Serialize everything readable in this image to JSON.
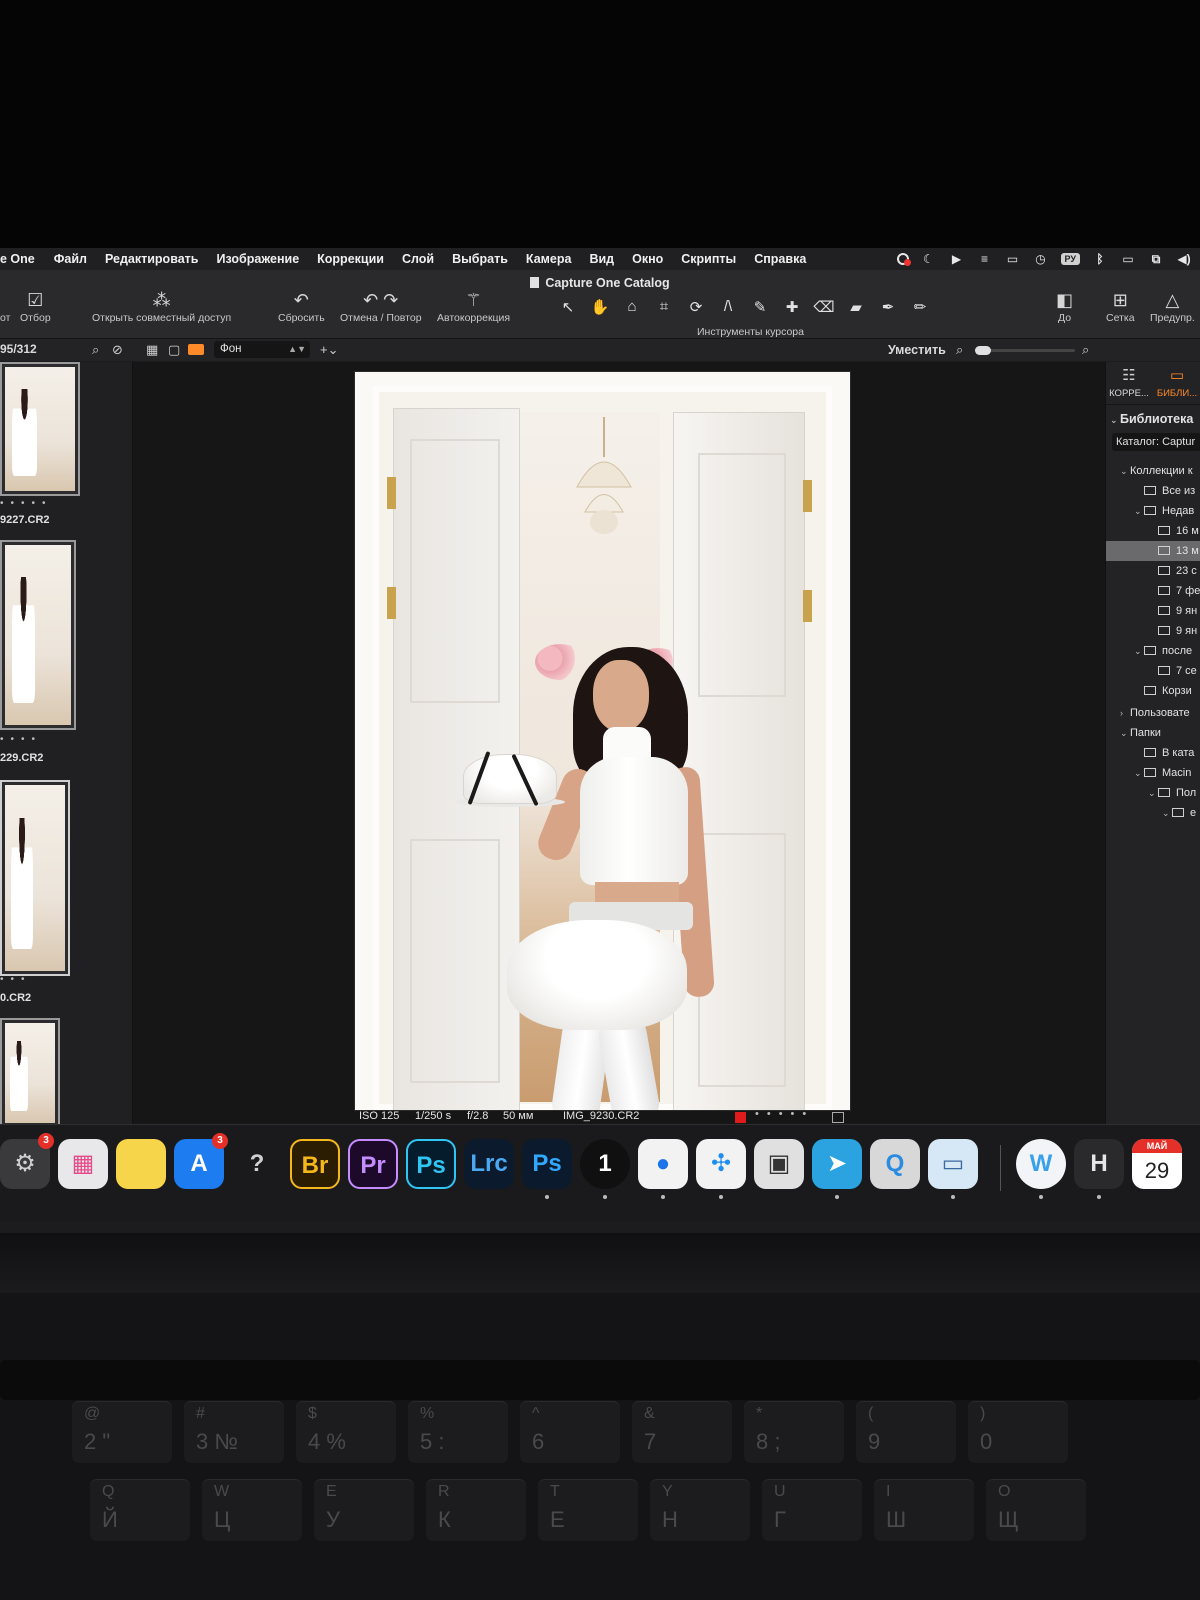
{
  "menubar": {
    "app_name": "e One",
    "items": [
      "Файл",
      "Редактировать",
      "Изображение",
      "Коррекции",
      "Слой",
      "Выбрать",
      "Камера",
      "Вид",
      "Окно",
      "Скрипты",
      "Справка"
    ],
    "lang_badge": "РУ"
  },
  "window": {
    "title": "Capture One Catalog"
  },
  "toolbar": {
    "partial_left": "от",
    "cull_label": "Отбор",
    "share_label": "Открыть совместный доступ",
    "reset_label": "Сбросить",
    "undo_redo_label": "Отмена / Повтор",
    "autoadjust_label": "Автокоррекция",
    "cursor_tools_label": "Инструменты курсора",
    "before_label": "До",
    "grid_label": "Сетка",
    "warnings_label": "Предупр."
  },
  "subbar": {
    "counter": "95/312",
    "style_select": "Фон",
    "fit_label": "Уместить"
  },
  "filmstrip": {
    "thumbnails": [
      {
        "label": "9227.CR2"
      },
      {
        "label": "229.CR2"
      },
      {
        "label": "0.CR2"
      },
      {
        "label": ""
      }
    ]
  },
  "viewer": {
    "iso": "ISO 125",
    "shutter": "1/250 s",
    "aperture": "f/2.8",
    "focal": "50 мм",
    "filename": "IMG_9230.CR2",
    "rating_stars": 0,
    "color_tag": "#e01b1b"
  },
  "right_panel": {
    "tab_adjust": "КОРРЕ...",
    "tab_library": "БИБЛИ...",
    "section_title": "Библиотека",
    "catalog_label": "Каталог: Captur",
    "tree": [
      {
        "label": "Коллекции к",
        "indent": 0,
        "chev": "v",
        "selected": false
      },
      {
        "label": "Все из",
        "indent": 1,
        "chev": "",
        "selected": false
      },
      {
        "label": "Недав",
        "indent": 1,
        "chev": "v",
        "selected": false
      },
      {
        "label": "16 м",
        "indent": 2,
        "chev": "",
        "selected": false
      },
      {
        "label": "13 м",
        "indent": 2,
        "chev": "",
        "selected": true
      },
      {
        "label": "23 с",
        "indent": 2,
        "chev": "",
        "selected": false
      },
      {
        "label": "7 фе",
        "indent": 2,
        "chev": "",
        "selected": false
      },
      {
        "label": "9 ян",
        "indent": 2,
        "chev": "",
        "selected": false
      },
      {
        "label": "9 ян",
        "indent": 2,
        "chev": "",
        "selected": false
      },
      {
        "label": "после",
        "indent": 1,
        "chev": "v",
        "selected": false
      },
      {
        "label": "7 се",
        "indent": 2,
        "chev": "",
        "selected": false
      },
      {
        "label": "Корзи",
        "indent": 1,
        "chev": "",
        "selected": false
      },
      {
        "label": "Пользовате",
        "indent": 0,
        "chev": ">",
        "selected": false
      },
      {
        "label": "Папки",
        "indent": 0,
        "chev": "v",
        "selected": false
      },
      {
        "label": "В ката",
        "indent": 1,
        "chev": "",
        "selected": false
      },
      {
        "label": "Macin",
        "indent": 1,
        "chev": "v",
        "selected": false
      },
      {
        "label": "Пол",
        "indent": 2,
        "chev": "v",
        "selected": false
      },
      {
        "label": "е",
        "indent": 3,
        "chev": "v",
        "selected": false
      }
    ]
  },
  "dock": {
    "apps": [
      {
        "name": "system-settings",
        "text": "⚙",
        "badge": "3",
        "bg": "#3a3a3c",
        "fg": "#cfcfcf"
      },
      {
        "name": "launchpad",
        "text": "▦",
        "badge": "",
        "bg": "#e8e8ea",
        "fg": "#e64a8a"
      },
      {
        "name": "notes",
        "text": "",
        "badge": "",
        "bg": "#f7d54a",
        "fg": "#ffffff"
      },
      {
        "name": "app-store",
        "text": "A",
        "badge": "3",
        "bg": "#1c7cf0",
        "fg": "#ffffff"
      },
      {
        "name": "help",
        "text": "?",
        "badge": "",
        "bg": "transparent",
        "fg": "#d0d0d0"
      },
      {
        "name": "bridge",
        "text": "Br",
        "badge": "",
        "bg": "#2b1d02",
        "fg": "#f5b81c"
      },
      {
        "name": "premiere",
        "text": "Pr",
        "badge": "",
        "bg": "#1d0a2b",
        "fg": "#c58cff"
      },
      {
        "name": "photoshop",
        "text": "Ps",
        "badge": "",
        "bg": "#041c2c",
        "fg": "#31c5f4"
      },
      {
        "name": "lightroom-classic",
        "text": "Lrc",
        "badge": "",
        "bg": "#0b1a2c",
        "fg": "#4aa8f0"
      },
      {
        "name": "photoshop-2",
        "text": "Ps",
        "badge": "",
        "bg": "#0b1a2c",
        "fg": "#31a8ff"
      },
      {
        "name": "capture-one",
        "text": "1",
        "badge": "",
        "bg": "#101010",
        "fg": "#ffffff"
      },
      {
        "name": "chrome",
        "text": "●",
        "badge": "",
        "bg": "#f2f2f2",
        "fg": "#1a73e8"
      },
      {
        "name": "safari",
        "text": "✣",
        "badge": "",
        "bg": "#f2f2f2",
        "fg": "#1f8ef1"
      },
      {
        "name": "image-capture",
        "text": "▣",
        "badge": "",
        "bg": "#e0e0e0",
        "fg": "#333333"
      },
      {
        "name": "telegram",
        "text": "➤",
        "badge": "",
        "bg": "#2aa3e0",
        "fg": "#ffffff"
      },
      {
        "name": "quicktime",
        "text": "Q",
        "badge": "",
        "bg": "#d8d8d8",
        "fg": "#2a8be0"
      },
      {
        "name": "preview",
        "text": "▭",
        "badge": "",
        "bg": "#d6e8f6",
        "fg": "#3a6aa0"
      },
      {
        "name": "w-app",
        "text": "W",
        "badge": "",
        "bg": "#f2f4f7",
        "fg": "#3aa0e8"
      },
      {
        "name": "h-app",
        "text": "H",
        "badge": "",
        "bg": "#2a2a2c",
        "fg": "#e6e6e6"
      },
      {
        "name": "calendar",
        "text": "29",
        "badge": "",
        "bg": "#ffffff",
        "fg": "#222222",
        "month": "МАЙ"
      }
    ]
  },
  "keyboard": {
    "row1": [
      {
        "up": "@",
        "dn": "2  \""
      },
      {
        "up": "#",
        "dn": "3  №"
      },
      {
        "up": "$",
        "dn": "4  %"
      },
      {
        "up": "%",
        "dn": "5  :"
      },
      {
        "up": "^",
        "dn": "6"
      },
      {
        "up": "&",
        "dn": "7"
      },
      {
        "up": "*",
        "dn": "8  ;"
      },
      {
        "up": "(",
        "dn": "9"
      },
      {
        "up": ")",
        "dn": "0"
      }
    ],
    "row2": [
      {
        "up": "Q",
        "dn": "Й"
      },
      {
        "up": "W",
        "dn": "Ц"
      },
      {
        "up": "E",
        "dn": "У"
      },
      {
        "up": "R",
        "dn": "К"
      },
      {
        "up": "T",
        "dn": "Е"
      },
      {
        "up": "Y",
        "dn": "Н"
      },
      {
        "up": "U",
        "dn": "Г"
      },
      {
        "up": "I",
        "dn": "Ш"
      },
      {
        "up": "O",
        "dn": "Щ"
      }
    ]
  }
}
